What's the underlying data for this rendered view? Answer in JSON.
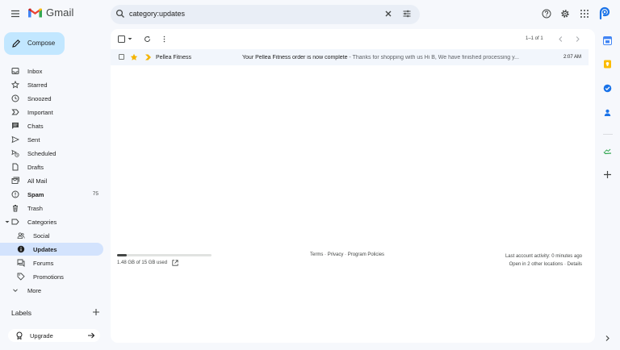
{
  "app": {
    "logo_text": "Gmail",
    "brand_colors": {
      "red": "#ea4335",
      "blue": "#4285f4",
      "yellow": "#fbbc04",
      "green": "#34a853"
    }
  },
  "search": {
    "value": "category:updates"
  },
  "compose": {
    "label": "Compose"
  },
  "sidebar": {
    "items": [
      {
        "label": "Inbox",
        "icon": "inbox-icon"
      },
      {
        "label": "Starred",
        "icon": "star-icon"
      },
      {
        "label": "Snoozed",
        "icon": "clock-icon"
      },
      {
        "label": "Important",
        "icon": "important-icon"
      },
      {
        "label": "Chats",
        "icon": "chat-icon"
      },
      {
        "label": "Sent",
        "icon": "send-icon"
      },
      {
        "label": "Scheduled",
        "icon": "schedule-send-icon"
      },
      {
        "label": "Drafts",
        "icon": "draft-icon"
      },
      {
        "label": "All Mail",
        "icon": "all-mail-icon"
      },
      {
        "label": "Spam",
        "icon": "spam-icon",
        "count": "75"
      },
      {
        "label": "Trash",
        "icon": "trash-icon"
      },
      {
        "label": "Categories",
        "icon": "label-icon"
      },
      {
        "label": "Social",
        "icon": "social-icon"
      },
      {
        "label": "Updates",
        "icon": "info-icon"
      },
      {
        "label": "Forums",
        "icon": "forum-icon"
      },
      {
        "label": "Promotions",
        "icon": "tag-icon"
      },
      {
        "label": "More",
        "icon": "chevron-down-icon"
      }
    ],
    "labels_header": "Labels",
    "upgrade_label": "Upgrade"
  },
  "toolbar": {
    "pager": "1–1 of 1"
  },
  "emails": [
    {
      "sender": "Pellea Fitness",
      "subject": "Your Pellea Fitness order is now complete",
      "snippet": " - Thanks for shopping with us Hi B, We have finished processing y...",
      "time": "2:07 AM",
      "starred": true,
      "important": true
    }
  ],
  "footer": {
    "storage_text": "1.48 GB of 15 GB used",
    "storage_fraction": 0.099,
    "links": [
      "Terms",
      "Privacy",
      "Program Policies"
    ],
    "separator": " · ",
    "activity": "Last account activity: 0 minutes ago",
    "other_locations": "Open in 2 other locations",
    "details": "Details"
  }
}
